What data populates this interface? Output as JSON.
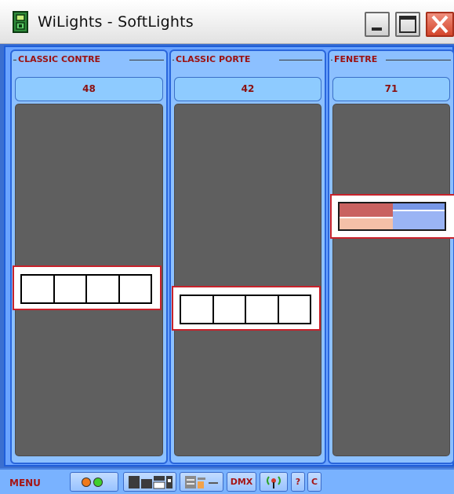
{
  "window": {
    "title": "WiLights - SoftLights"
  },
  "panels": [
    {
      "title": "CLASSIC CONTRE",
      "value": "48",
      "type": "cells"
    },
    {
      "title": "CLASSIC PORTE",
      "value": "42",
      "type": "cells"
    },
    {
      "title": "FENETRE",
      "value": "71",
      "type": "color"
    }
  ],
  "menubar": {
    "menu_label": "MENU",
    "dmx_label": "DMX",
    "help_label": "?",
    "c_label": "C"
  },
  "colors": {
    "title_text": "#9b1111",
    "panel_bg": "#8cc0ff",
    "track": "#5f5f5f",
    "handle_border": "#c8222b",
    "window_frame": "#3b6fd0"
  },
  "icons": {
    "app": "app-lamp-icon",
    "minimize": "minimize-icon",
    "maximize": "maximize-icon",
    "close": "close-icon",
    "leds": "status-leds-icon",
    "layout_a": "layout-grid-icon",
    "layout_b": "layout-list-icon",
    "wireless": "wireless-antenna-icon"
  }
}
